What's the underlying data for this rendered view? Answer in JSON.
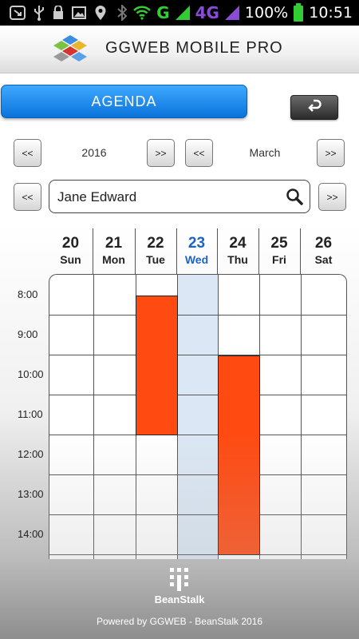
{
  "status_bar": {
    "network_g": "G",
    "network_4g": "4G",
    "battery_pct": "100%",
    "time": "10:51",
    "icons": [
      "notification-icon",
      "usb-icon",
      "lock-icon",
      "image-icon",
      "location-icon",
      "bluetooth-icon",
      "wifi-icon",
      "signal-icon",
      "battery-icon"
    ]
  },
  "header": {
    "title": "GGWEB MOBILE PRO"
  },
  "toolbar": {
    "agenda_label": "AGENDA",
    "back_icon": "back-arrow-icon"
  },
  "year_nav": {
    "prev_label": "<<",
    "value": "2016",
    "next_label": ">>"
  },
  "month_nav": {
    "prev_label": "<<",
    "value": "March",
    "next_label": ">>"
  },
  "person_nav": {
    "prev_label": "<<",
    "name": "Jane Edward",
    "next_label": ">>"
  },
  "calendar": {
    "days": [
      {
        "num": "20",
        "name": "Sun"
      },
      {
        "num": "21",
        "name": "Mon"
      },
      {
        "num": "22",
        "name": "Tue"
      },
      {
        "num": "23",
        "name": "Wed"
      },
      {
        "num": "24",
        "name": "Thu"
      },
      {
        "num": "25",
        "name": "Fri"
      },
      {
        "num": "26",
        "name": "Sat"
      }
    ],
    "today_index": 3,
    "times": [
      "8:00",
      "9:00",
      "10:00",
      "11:00",
      "12:00",
      "13:00",
      "14:00"
    ],
    "events": [
      {
        "day": "Tue",
        "start": "8:00",
        "end": "11:30",
        "color": "#ff4a12"
      },
      {
        "day": "Thu",
        "start": "9:30",
        "end": "14:30",
        "color": "#ff4a12"
      }
    ],
    "today_color": "#dbe7f4",
    "today_text_color": "#1d63c2"
  },
  "footer": {
    "brand": "BeanStalk",
    "powered_by": "Powered by GGWEB - BeanStalk 2016"
  }
}
